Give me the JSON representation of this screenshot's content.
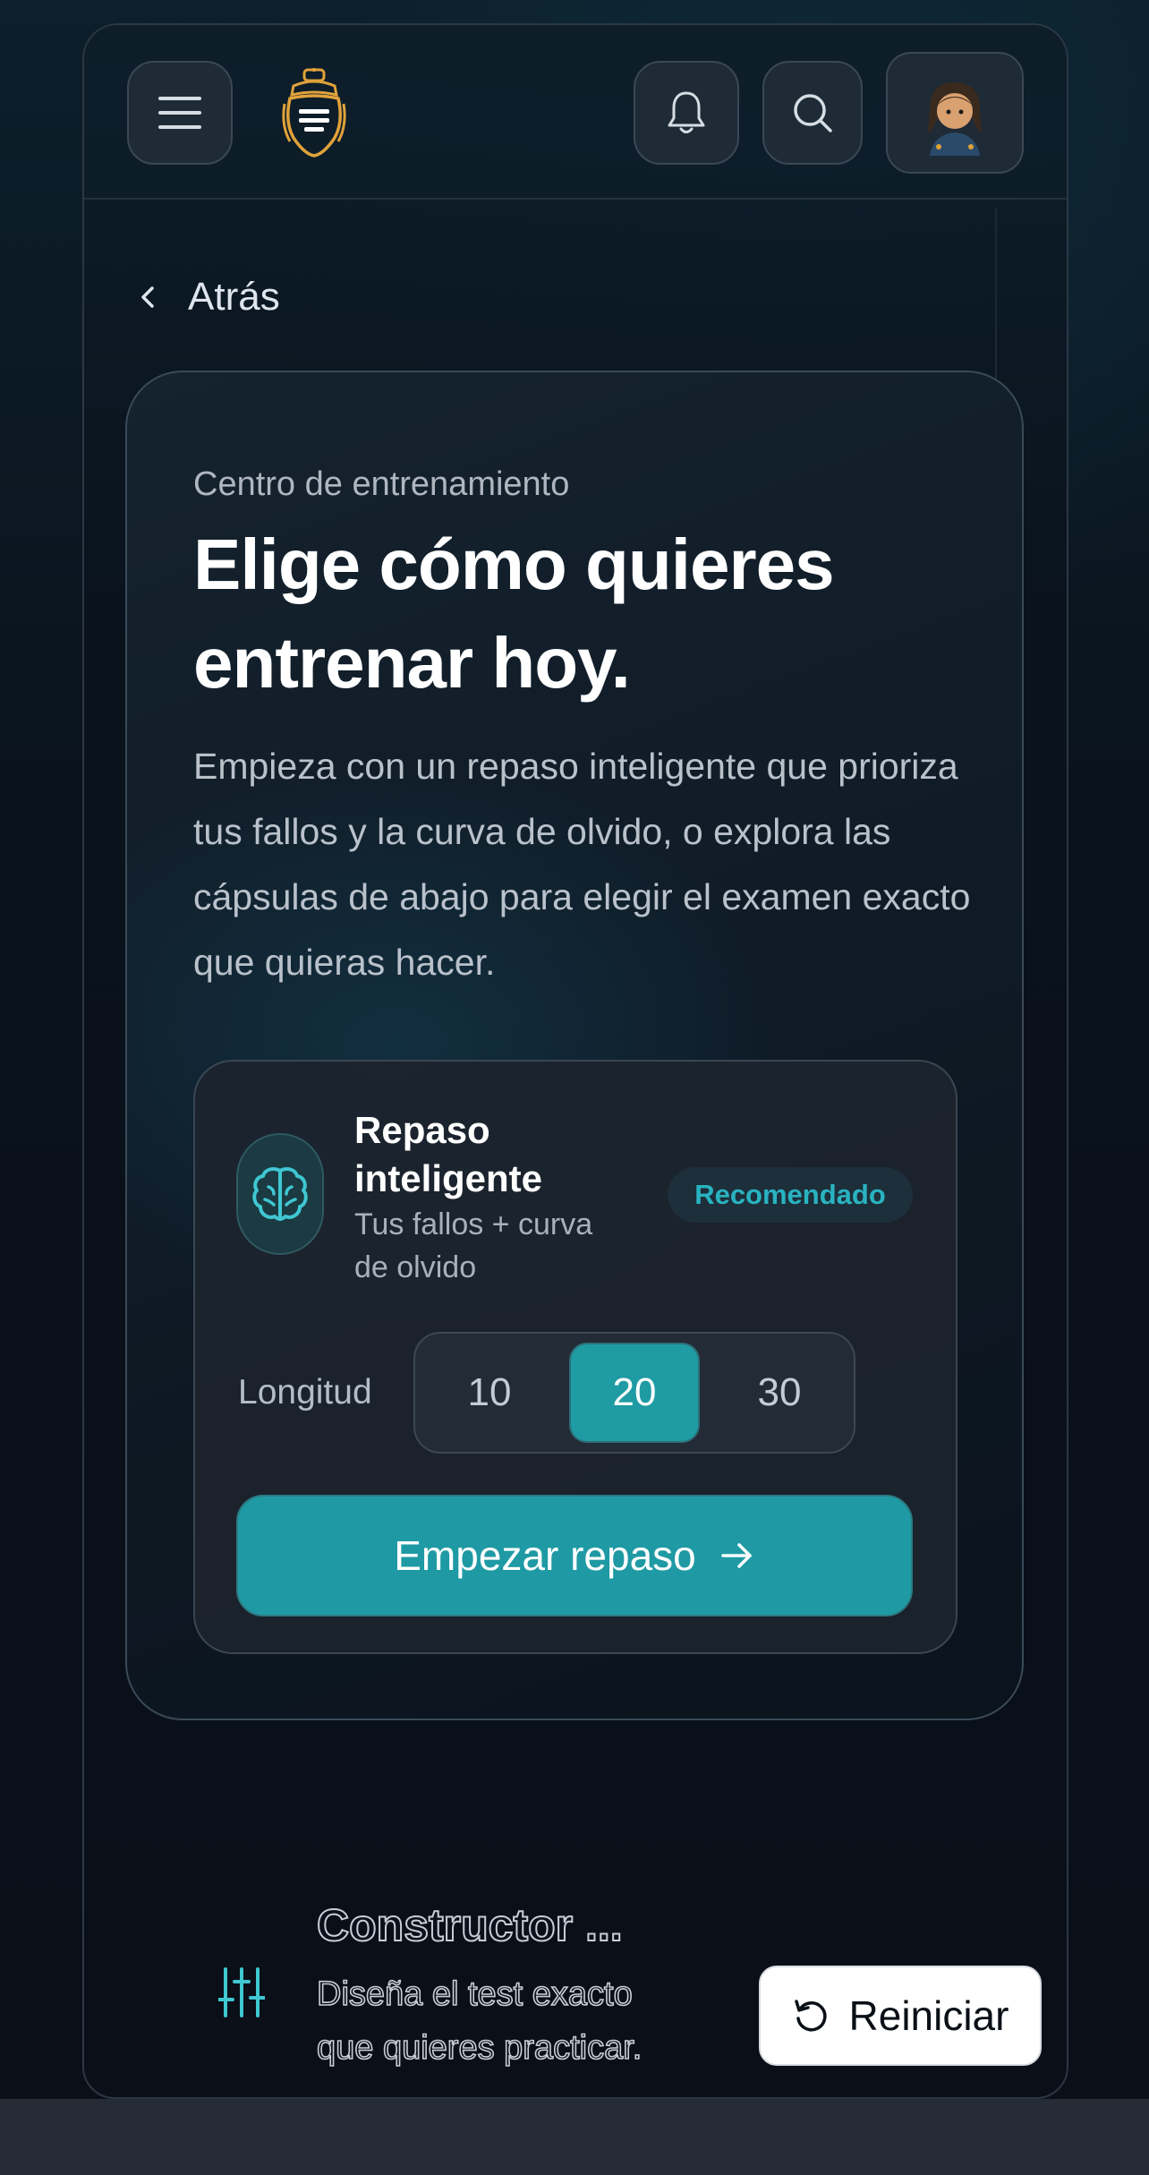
{
  "header": {
    "menu_icon": "hamburger-menu-icon",
    "logo_icon": "crest-logo-icon",
    "bell_icon": "bell-icon",
    "search_icon": "search-icon",
    "avatar_icon": "user-avatar"
  },
  "nav": {
    "back_label": "Atrás"
  },
  "hero": {
    "eyebrow": "Centro de entrenamiento",
    "title": "Elige cómo quieres entrenar hoy.",
    "description": "Empieza con un repaso inteligente que prioriza tus fallos y la curva de olvido, o explora las cápsulas de abajo para elegir el examen exacto que quieras hacer."
  },
  "smart_review": {
    "icon": "brain-icon",
    "title": "Repaso inteligente",
    "subtitle": "Tus fallos + curva de olvido",
    "badge": "Recomendado",
    "length_label": "Longitud",
    "length_options": [
      "10",
      "20",
      "30"
    ],
    "selected_length": "20",
    "start_label": "Empezar repaso"
  },
  "builder": {
    "icon": "sliders-icon",
    "title": "Constructor ...",
    "description": "Diseña el test exacto que quieres practicar.",
    "reset_label": "Reiniciar"
  },
  "colors": {
    "accent": "#1f9aa4",
    "badge_text": "#29b3c1",
    "logo_gold": "#e0a23a"
  }
}
